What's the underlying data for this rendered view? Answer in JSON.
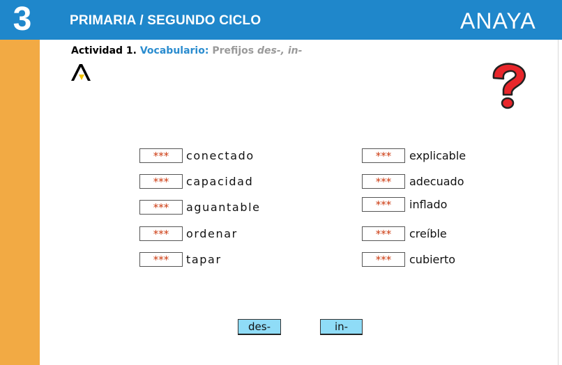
{
  "header": {
    "grade": "3",
    "title": "PRIMARIA / SEGUNDO CICLO",
    "brand": "ANAYA"
  },
  "activity": {
    "label": "Actividad 1.",
    "topic": "Vocabulario:",
    "subtitle": "Prefijos",
    "prefixes": "des-, in-"
  },
  "left_items": [
    {
      "slot": "***",
      "word": "conectado"
    },
    {
      "slot": "***",
      "word": "capacidad"
    },
    {
      "slot": "***",
      "word": "aguantable"
    },
    {
      "slot": "***",
      "word": "ordenar"
    },
    {
      "slot": "***",
      "word": "tapar"
    }
  ],
  "right_items": [
    {
      "slot": "***",
      "word": "explicable"
    },
    {
      "slot": "***",
      "word": "adecuado"
    },
    {
      "slot": "***",
      "word": "inflado"
    },
    {
      "slot": "***",
      "word": "creíble"
    },
    {
      "slot": "***",
      "word": "cubierto"
    }
  ],
  "options": {
    "des": "des-",
    "in": "in-"
  },
  "colors": {
    "header": "#1f87cb",
    "sidebar": "#f2aa44",
    "slot_text": "#cc3a10",
    "option_button": "#8fdcf7",
    "help_icon": "#e8262b"
  },
  "icons": {
    "help": "question-mark-icon",
    "logo": "anaya-a-logo-icon"
  }
}
